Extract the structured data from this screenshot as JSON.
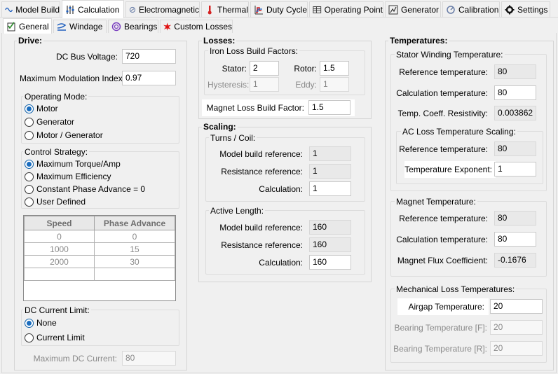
{
  "top_tabs": [
    {
      "label": "Model Build",
      "icon": "sine-wave-icon"
    },
    {
      "label": "Calculation",
      "icon": "sliders-icon"
    },
    {
      "label": "Electromagnetic",
      "icon": "magnet-icon"
    },
    {
      "label": "Thermal",
      "icon": "thermometer-icon"
    },
    {
      "label": "Duty Cycle",
      "icon": "duty-cycle-icon"
    },
    {
      "label": "Operating Point",
      "icon": "grid-icon"
    },
    {
      "label": "Generator",
      "icon": "generator-icon"
    },
    {
      "label": "Calibration",
      "icon": "calibration-icon"
    },
    {
      "label": "Settings",
      "icon": "gear-icon"
    }
  ],
  "sub_tabs": [
    {
      "label": "General",
      "icon": "checklist-icon"
    },
    {
      "label": "Windage",
      "icon": "windage-icon"
    },
    {
      "label": "Bearings",
      "icon": "bearing-icon"
    },
    {
      "label": "Custom Losses",
      "icon": "burst-icon"
    }
  ],
  "drive": {
    "title": "Drive:",
    "dc_bus_voltage_label": "DC Bus Voltage:",
    "dc_bus_voltage": "720",
    "max_mod_label": "Maximum Modulation Index:",
    "max_mod": "0.97",
    "operating_mode": {
      "title": "Operating Mode:",
      "options": [
        "Motor",
        "Generator",
        "Motor / Generator"
      ],
      "selected": "Motor"
    },
    "control_strategy": {
      "title": "Control Strategy:",
      "options": [
        "Maximum Torque/Amp",
        "Maximum Efficiency",
        "Constant Phase Advance = 0",
        "User Defined"
      ],
      "selected": "Maximum Torque/Amp"
    },
    "phase_table": {
      "headers": [
        "Speed",
        "Phase Advance"
      ],
      "rows": [
        [
          "0",
          "0"
        ],
        [
          "1000",
          "15"
        ],
        [
          "2000",
          "30"
        ]
      ]
    },
    "dc_current_limit": {
      "title": "DC Current Limit:",
      "options": [
        "None",
        "Current Limit"
      ],
      "selected": "None"
    },
    "max_dc_current_label": "Maximum DC Current:",
    "max_dc_current": "80"
  },
  "losses": {
    "title": "Losses:",
    "iron_title": "Iron Loss Build Factors:",
    "stator_label": "Stator:",
    "stator": "2",
    "rotor_label": "Rotor:",
    "rotor": "1.5",
    "hysteresis_label": "Hysteresis:",
    "hysteresis": "1",
    "eddy_label": "Eddy:",
    "eddy": "1",
    "magnet_label": "Magnet Loss Build Factor:",
    "magnet": "1.5"
  },
  "scaling": {
    "title": "Scaling:",
    "turns_title": "Turns / Coil:",
    "turns_model_label": "Model build reference:",
    "turns_model": "1",
    "turns_res_label": "Resistance reference:",
    "turns_res": "1",
    "turns_calc_label": "Calculation:",
    "turns_calc": "1",
    "active_title": "Active Length:",
    "active_model_label": "Model build reference:",
    "active_model": "160",
    "active_res_label": "Resistance reference:",
    "active_res": "160",
    "active_calc_label": "Calculation:",
    "active_calc": "160"
  },
  "temperatures": {
    "title": "Temperatures:",
    "stator_title": "Stator Winding Temperature:",
    "sw_ref_label": "Reference temperature:",
    "sw_ref": "80",
    "sw_calc_label": "Calculation temperature:",
    "sw_calc": "80",
    "sw_coeff_label": "Temp. Coeff. Resistivity:",
    "sw_coeff": "0.003862",
    "ac_title": "AC Loss Temperature Scaling:",
    "ac_ref_label": "Reference temperature:",
    "ac_ref": "80",
    "ac_exp_label": "Temperature Exponent:",
    "ac_exp": "1",
    "magnet_title": "Magnet Temperature:",
    "mg_ref_label": "Reference temperature:",
    "mg_ref": "80",
    "mg_calc_label": "Calculation temperature:",
    "mg_calc": "80",
    "mg_flux_label": "Magnet Flux Coefficient:",
    "mg_flux": "-0.1676",
    "mech_title": "Mechanical Loss Temperatures:",
    "airgap_label": "Airgap Temperature:",
    "airgap": "20",
    "bearing_f_label": "Bearing Temperature [F]:",
    "bearing_f": "20",
    "bearing_r_label": "Bearing Temperature [R]:",
    "bearing_r": "20"
  }
}
